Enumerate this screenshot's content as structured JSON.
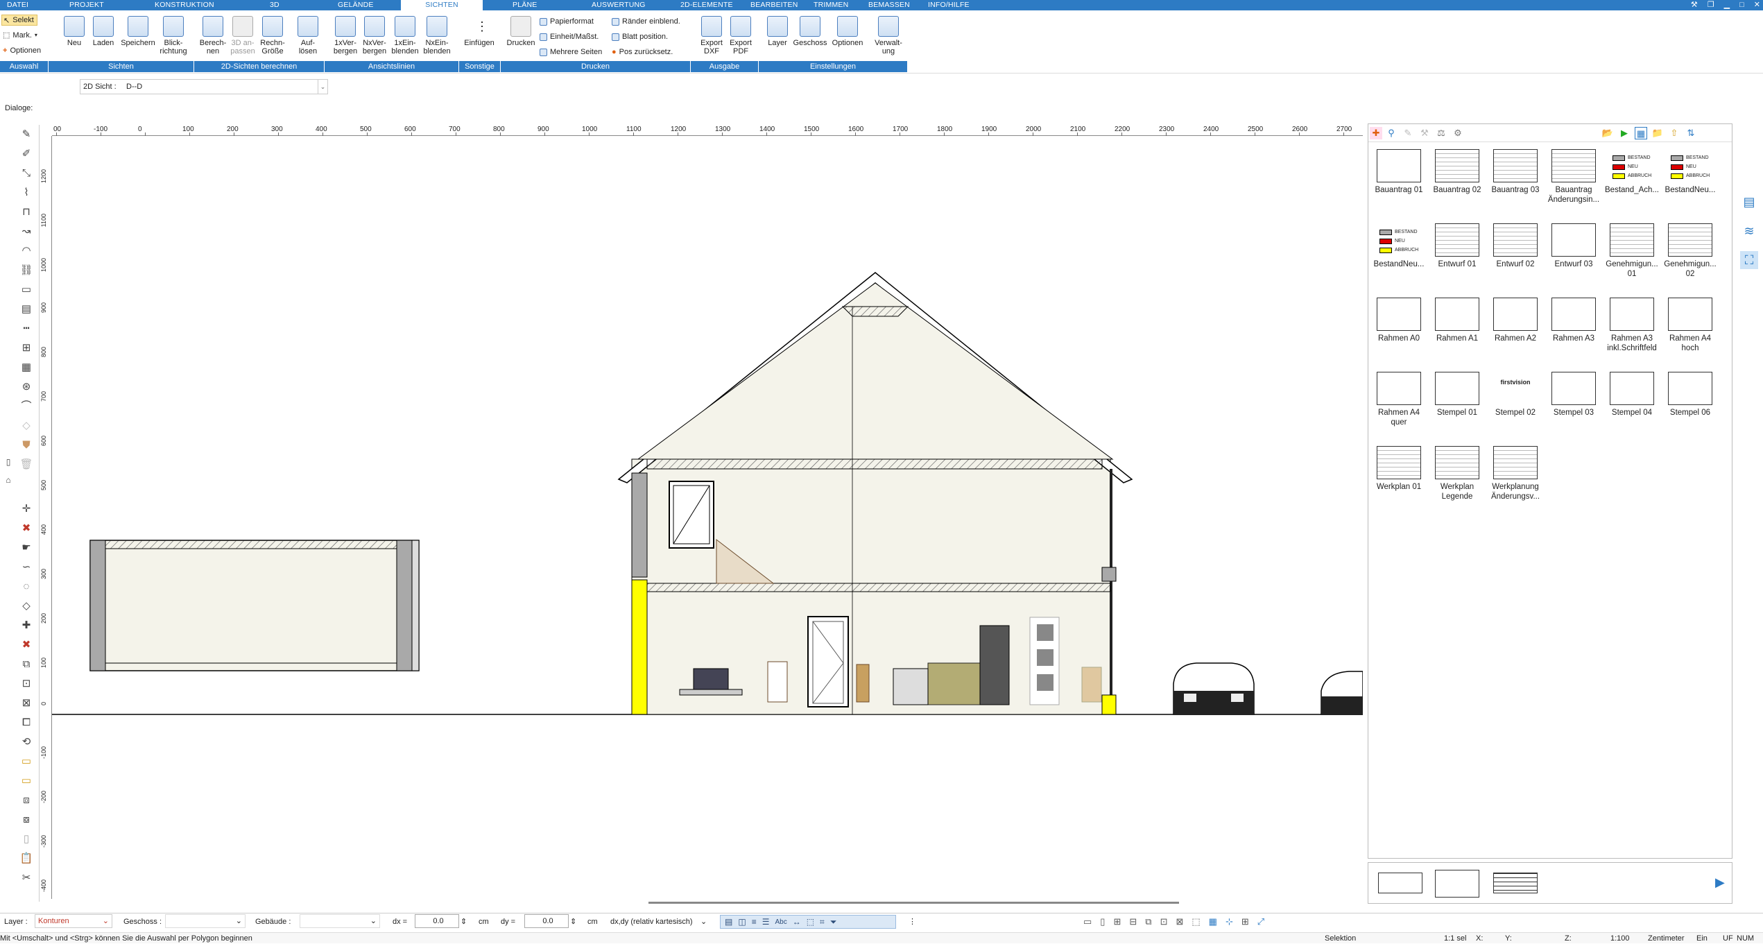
{
  "menu": {
    "items": [
      "DATEI",
      "PROJEKT",
      "KONSTRUKTION",
      "3D",
      "GELÄNDE",
      "SICHTEN",
      "PLÄNE",
      "AUSWERTUNG",
      "2D-ELEMENTE",
      "BEARBEITEN",
      "TRIMMEN",
      "BEMASSEN",
      "INFO/HILFE"
    ],
    "active": "SICHTEN"
  },
  "ribbon": {
    "auswahl": {
      "selekt": "Selekt",
      "mark": "Mark.",
      "optionen": "Optionen"
    },
    "sichten": {
      "neu": "Neu",
      "laden": "Laden",
      "speichern": "Speichern",
      "blickrichtung": "Blick-\nrichtung"
    },
    "berechnen": {
      "berechnen": "Berech-\nnen",
      "anpassen": "3D an-\npassen",
      "rechngroesse": "Rechn-\nGröße",
      "aufloesen": "Auf-\nlösen"
    },
    "ansichtslinien": {
      "verbergen1": "1xVer-\nbergen",
      "verbergenN": "NxVer-\nbergen",
      "einblenden1": "1xEin-\nblenden",
      "einblendenN": "NxEin-\nblenden"
    },
    "sonstige": {
      "einfuegen": "Einfügen"
    },
    "drucken": {
      "drucken": "Drucken",
      "papierformat": "Papierformat",
      "einheit": "Einheit/Maßst.",
      "mehrere": "Mehrere Seiten",
      "raender": "Ränder einblend.",
      "blatt": "Blatt position.",
      "pos": "Pos zurücksetz."
    },
    "ausgabe": {
      "dxf": "Export\nDXF",
      "pdf": "Export\nPDF"
    },
    "einstellungen": {
      "layer": "Layer",
      "geschoss": "Geschoss",
      "optionen": "Optionen",
      "verwaltung": "Verwalt-\nung"
    },
    "groups": [
      "Auswahl",
      "Sichten",
      "2D-Sichten berechnen",
      "Ansichtslinien",
      "Sonstige",
      "Drucken",
      "Ausgabe",
      "Einstellungen"
    ]
  },
  "view": {
    "label": "2D Sicht :",
    "value": "D--D"
  },
  "dialoge": "Dialoge:",
  "ruler": {
    "h": [
      "00",
      "-100",
      "0",
      "100",
      "200",
      "300",
      "400",
      "500",
      "600",
      "700",
      "800",
      "900",
      "1000",
      "1100",
      "1200",
      "1300",
      "1400",
      "1500",
      "1600",
      "1700",
      "1800",
      "1900",
      "2000",
      "2100",
      "2200",
      "2300",
      "2400",
      "2500",
      "2600",
      "2700"
    ],
    "v": [
      "1200",
      "1100",
      "1000",
      "900",
      "800",
      "700",
      "600",
      "500",
      "400",
      "300",
      "200",
      "100",
      "0",
      "-100",
      "-200",
      "-300",
      "-400"
    ]
  },
  "library": [
    {
      "label": "Bauantrag 01"
    },
    {
      "label": "Bauantrag 02"
    },
    {
      "label": "Bauantrag 03"
    },
    {
      "label": "Bauantrag Änderungsin..."
    },
    {
      "label": "Bestand_Ach..."
    },
    {
      "label": "BestandNeu..."
    },
    {
      "label": "BestandNeu..."
    },
    {
      "label": "Entwurf 01"
    },
    {
      "label": "Entwurf 02"
    },
    {
      "label": "Entwurf 03"
    },
    {
      "label": "Genehmigun... 01"
    },
    {
      "label": "Genehmigun... 02"
    },
    {
      "label": "Rahmen A0"
    },
    {
      "label": "Rahmen A1"
    },
    {
      "label": "Rahmen A2"
    },
    {
      "label": "Rahmen A3"
    },
    {
      "label": "Rahmen A3 inkl.Schriftfeld"
    },
    {
      "label": "Rahmen A4 hoch"
    },
    {
      "label": "Rahmen A4 quer"
    },
    {
      "label": "Stempel 01"
    },
    {
      "label": "Stempel 02"
    },
    {
      "label": "Stempel 03"
    },
    {
      "label": "Stempel 04"
    },
    {
      "label": "Stempel 06"
    },
    {
      "label": "Werkplan 01"
    },
    {
      "label": "Werkplan Legende"
    },
    {
      "label": "Werkplanung Änderungsv..."
    }
  ],
  "legend": {
    "bestand": "BESTAND",
    "neu": "NEU",
    "abbruch": "ABBRUCH"
  },
  "stamp": {
    "firstvision": "firstvision"
  },
  "status": {
    "layer_label": "Layer :",
    "layer_value": "Konturen",
    "geschoss_label": "Geschoss :",
    "gebaeude_label": "Gebäude :",
    "dx_label": "dx =",
    "dx_value": "0.0",
    "dx_unit": "cm",
    "dy_label": "dy =",
    "dy_value": "0.0",
    "dy_unit": "cm",
    "mode": "dx,dy (relativ kartesisch)",
    "hint": "Mit <Umschalt> und <Strg> können Sie die Auswahl per Polygon beginnen",
    "selektion": "Selektion",
    "sel": "1:1 sel",
    "x": "X:",
    "y": "Y:",
    "z": "Z:",
    "scale": "1:100",
    "unit": "Zentimeter",
    "ein": "Ein",
    "uf": "UF",
    "num": "NUM"
  },
  "colors": {
    "accent": "#2d7bc4",
    "yellow": "#ffff00",
    "wall": "#a9a9a9",
    "room": "#f4f3ea"
  }
}
